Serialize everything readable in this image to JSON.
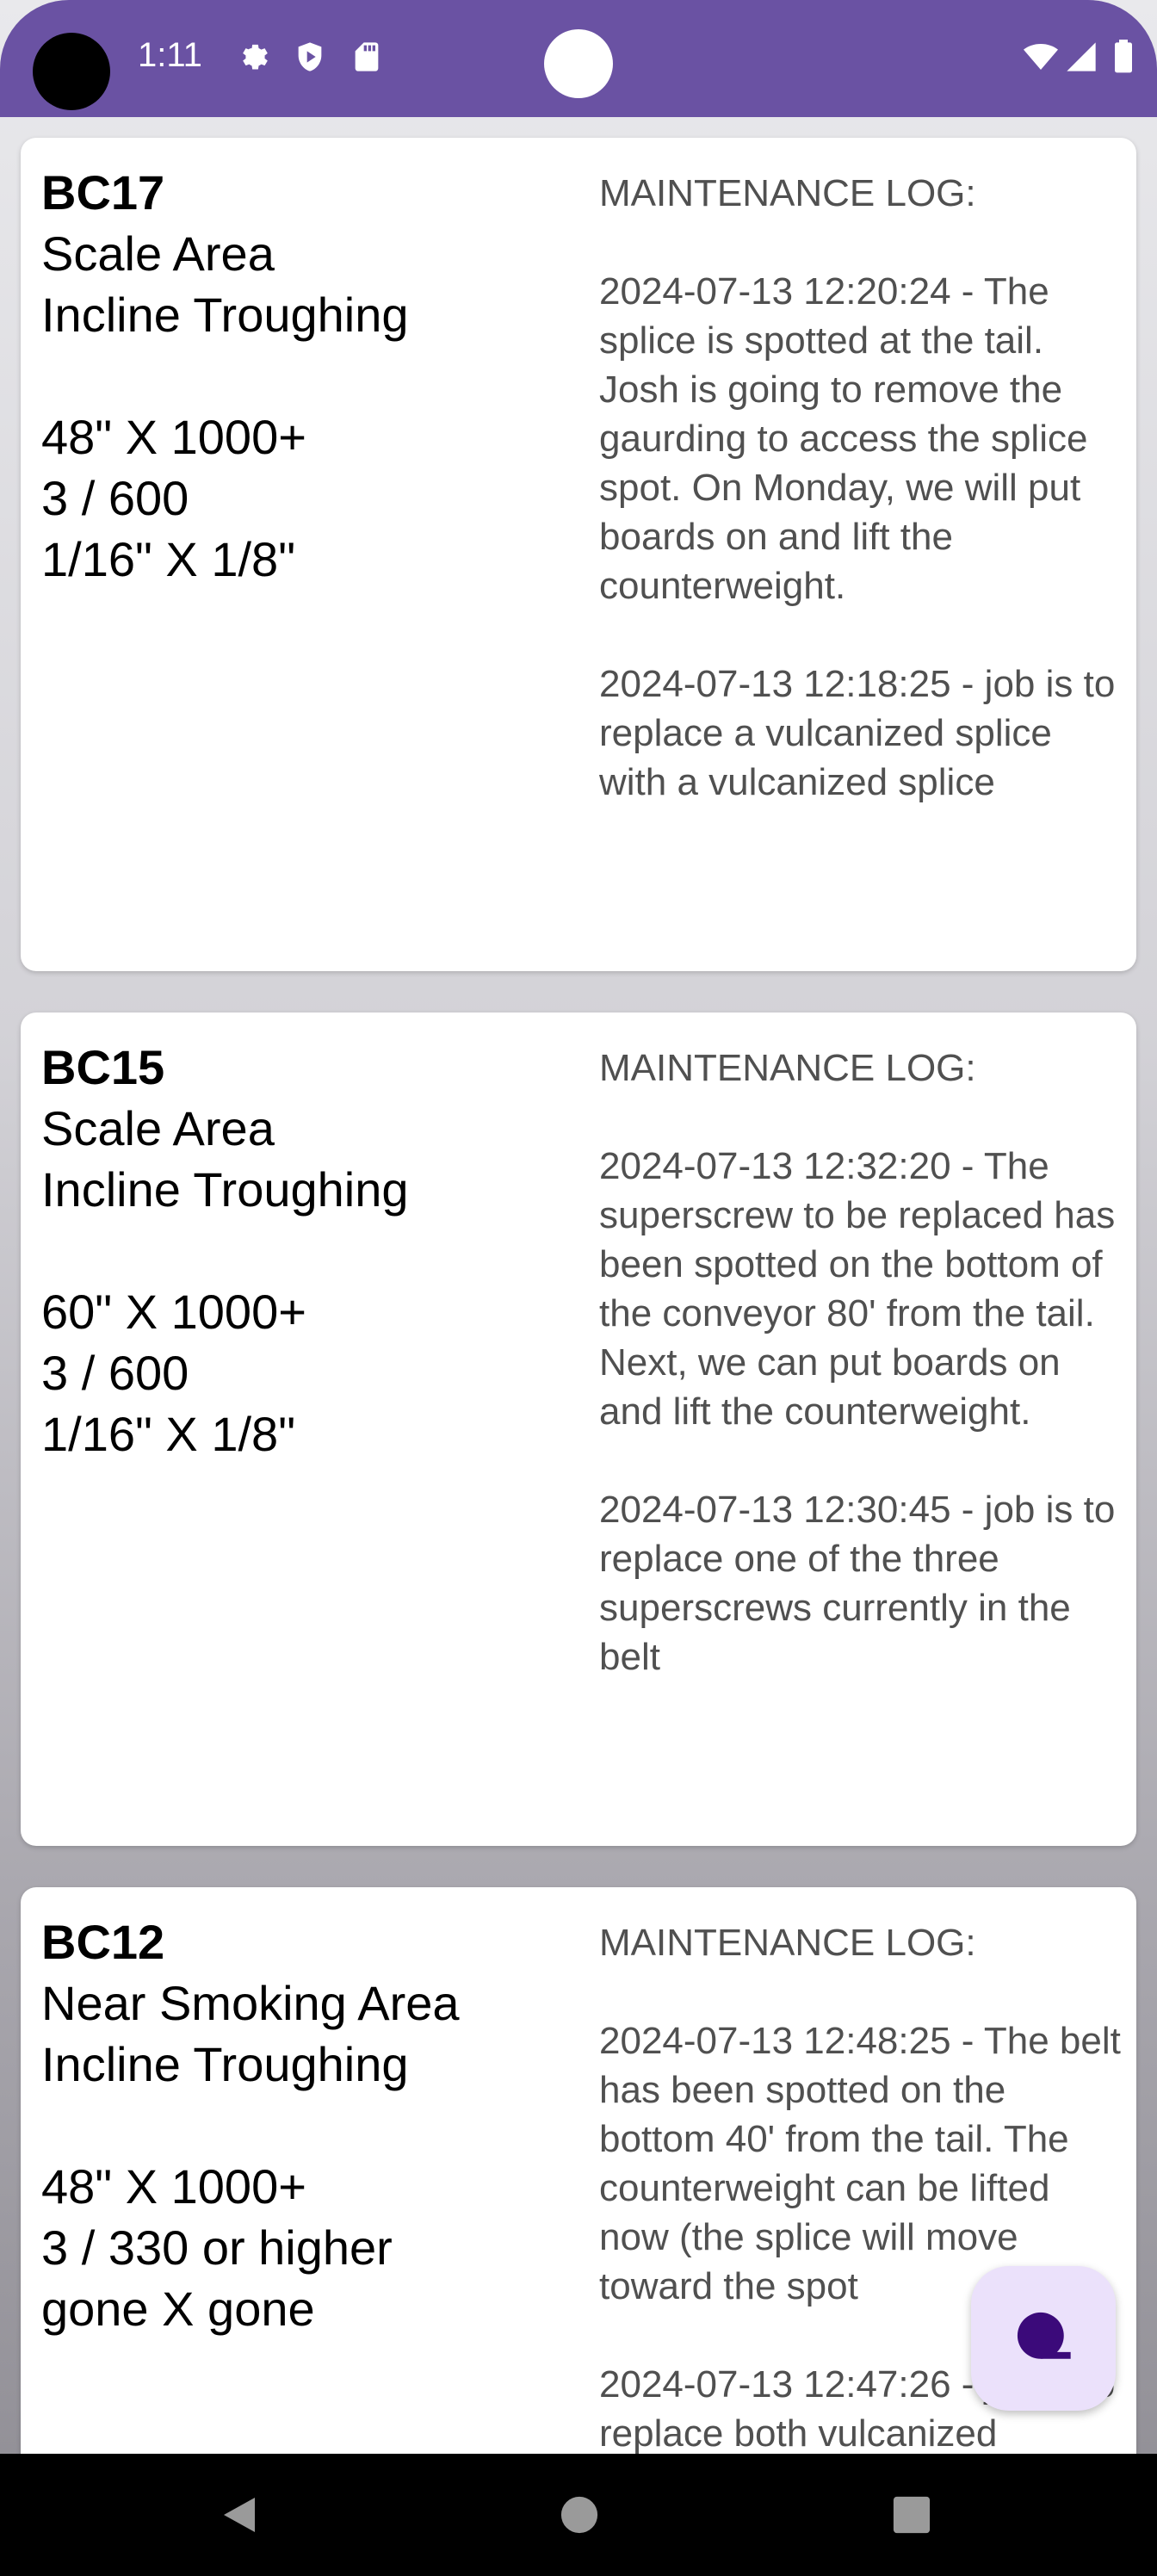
{
  "status_bar": {
    "time": "1:11",
    "left_icons": [
      "gear-icon",
      "shield-icon",
      "sd-card-icon"
    ],
    "right_icons": [
      "wifi-icon",
      "signal-icon",
      "battery-icon"
    ]
  },
  "cards": [
    {
      "id": "BC17",
      "area": "Scale Area",
      "type": "Incline Troughing",
      "belt_size": "48\" X 1000+",
      "ply_rating": "3 / 600",
      "covers": "1/16\" X 1/8\"",
      "log_title": "MAINTENANCE LOG:",
      "log_entries": [
        "2024-07-13 12:20:24 - The splice is spotted at the tail. Josh is going to remove the gaurding to access the splice spot. On Monday, we will put boards on and lift the counterweight.",
        "2024-07-13 12:18:25 - job is to replace a vulcanized splice with a vulcanized splice"
      ]
    },
    {
      "id": "BC15",
      "area": "Scale Area",
      "type": "Incline Troughing",
      "belt_size": "60\" X 1000+",
      "ply_rating": "3 / 600",
      "covers": "1/16\" X 1/8\"",
      "log_title": "MAINTENANCE LOG:",
      "log_entries": [
        "2024-07-13 12:32:20 - The superscrew to be replaced has been spotted on the bottom of the conveyor 80' from the tail. Next, we can put boards on and lift the counterweight.",
        "2024-07-13 12:30:45 - job is to replace one of the three superscrews currently in the belt"
      ]
    },
    {
      "id": "BC12",
      "area": "Near Smoking Area",
      "type": "Incline Troughing",
      "belt_size": "48\" X 1000+",
      "ply_rating": "3 / 330 or higher",
      "covers": "gone X gone",
      "log_title": "MAINTENANCE LOG:",
      "log_entries": [
        "2024-07-13 12:48:25 - The belt has been spotted on the bottom 40' from the tail. The counterweight can be lifted now (the splice will move toward the spot",
        "2024-07-13 12:47:26 - job is to replace both vulcanized"
      ]
    }
  ],
  "fab": {
    "icon": "chat-bubble-icon"
  },
  "nav_bar": {
    "buttons": [
      "back-icon",
      "home-icon",
      "recents-icon"
    ]
  }
}
